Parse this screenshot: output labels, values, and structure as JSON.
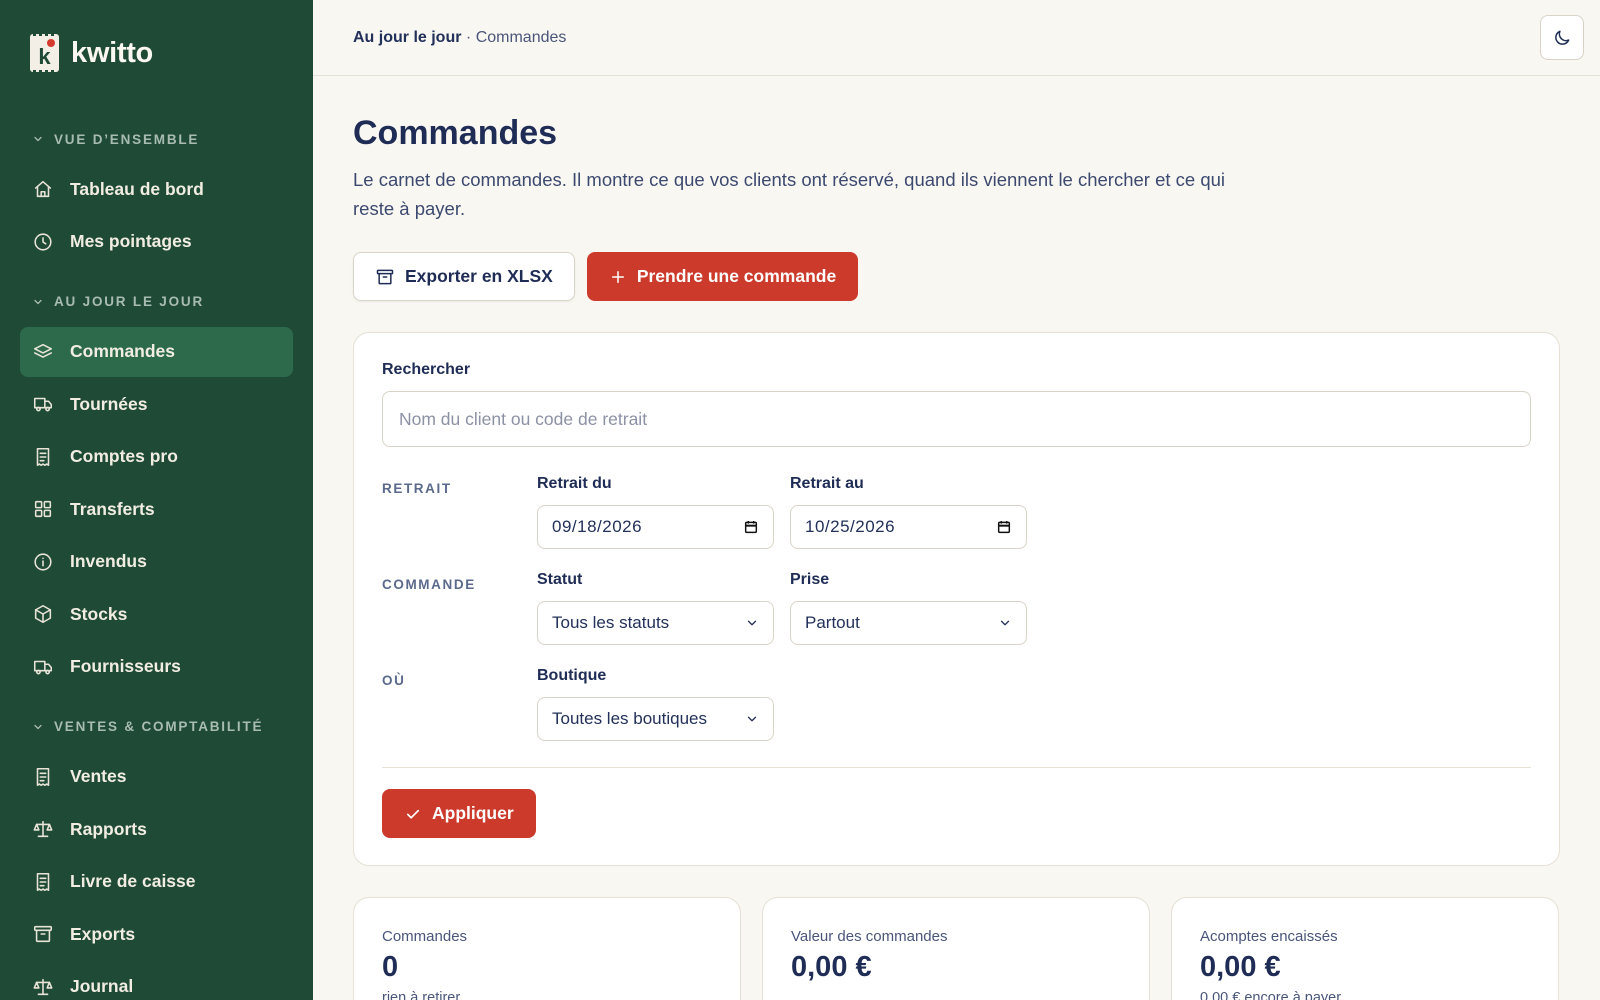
{
  "brand": {
    "name": "kwitto",
    "logo_letter": "k"
  },
  "sidebar": {
    "sections": [
      {
        "title": "VUE D’ENSEMBLE",
        "items": [
          {
            "label": "Tableau de bord",
            "icon": "home-icon"
          },
          {
            "label": "Mes pointages",
            "icon": "clock-icon"
          }
        ]
      },
      {
        "title": "AU JOUR LE JOUR",
        "items": [
          {
            "label": "Commandes",
            "icon": "layers-icon",
            "active": true
          },
          {
            "label": "Tournées",
            "icon": "truck-icon"
          },
          {
            "label": "Comptes pro",
            "icon": "receipt-icon"
          },
          {
            "label": "Transferts",
            "icon": "grid-icon"
          },
          {
            "label": "Invendus",
            "icon": "info-icon"
          },
          {
            "label": "Stocks",
            "icon": "box-icon"
          },
          {
            "label": "Fournisseurs",
            "icon": "truck-icon"
          }
        ]
      },
      {
        "title": "VENTES & COMPTABILITÉ",
        "items": [
          {
            "label": "Ventes",
            "icon": "receipt-icon"
          },
          {
            "label": "Rapports",
            "icon": "scale-icon"
          },
          {
            "label": "Livre de caisse",
            "icon": "receipt-icon"
          },
          {
            "label": "Exports",
            "icon": "archive-icon"
          },
          {
            "label": "Journal",
            "icon": "scale-icon"
          }
        ]
      }
    ]
  },
  "breadcrumb": {
    "parent": "Au jour le jour",
    "separator": "·",
    "current": "Commandes"
  },
  "header": {
    "theme_icon": "moon-icon"
  },
  "page": {
    "title": "Commandes",
    "description": "Le carnet de commandes. Il montre ce que vos clients ont réservé, quand ils viennent le chercher et ce qui reste à payer."
  },
  "actions": {
    "export_label": "Exporter en XLSX",
    "new_order_label": "Prendre une commande"
  },
  "filters": {
    "search_label": "Rechercher",
    "search_placeholder": "Nom du client ou code de retrait",
    "search_value": "",
    "groups": {
      "retrait": "RETRAIT",
      "commande": "COMMANDE",
      "ou": "OÙ"
    },
    "retrait_du_label": "Retrait du",
    "retrait_du_value": "09/18/2026",
    "retrait_au_label": "Retrait au",
    "retrait_au_value": "10/25/2026",
    "statut_label": "Statut",
    "statut_value": "Tous les statuts",
    "prise_label": "Prise",
    "prise_value": "Partout",
    "boutique_label": "Boutique",
    "boutique_value": "Toutes les boutiques",
    "apply_label": "Appliquer"
  },
  "stats": [
    {
      "label": "Commandes",
      "value": "0",
      "sub": "rien à retirer"
    },
    {
      "label": "Valeur des commandes",
      "value": "0,00 €",
      "sub": ""
    },
    {
      "label": "Acomptes encaissés",
      "value": "0,00 €",
      "sub": "0,00 € encore à payer"
    }
  ],
  "colors": {
    "sidebar": "#1f4a36",
    "sidebar_active": "#2d6a4c",
    "accent_red": "#cc3a2c",
    "background": "#f9f7f1"
  }
}
